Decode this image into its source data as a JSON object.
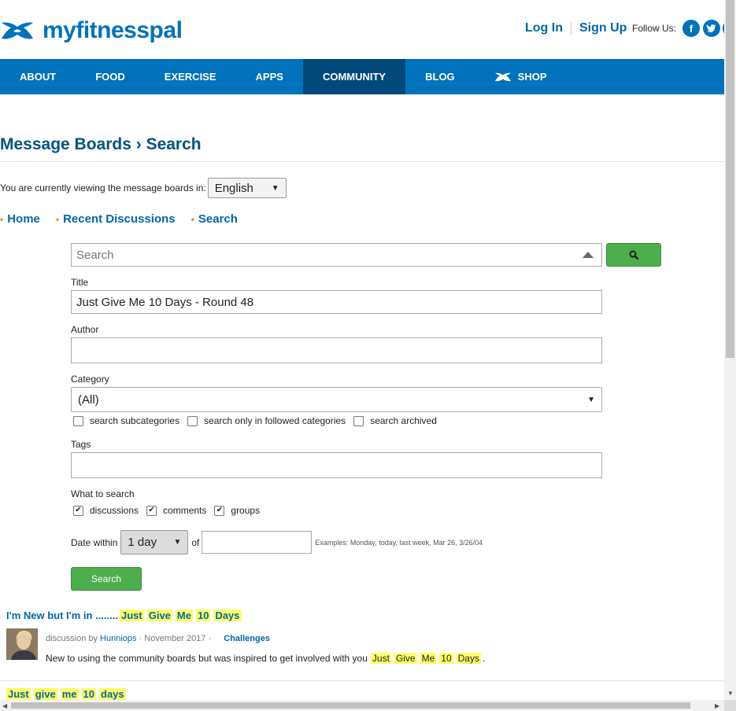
{
  "header": {
    "logo_text": "myfitnesspal",
    "login": "Log In",
    "signup": "Sign Up",
    "follow_us": "Follow Us:",
    "social": [
      "f",
      "t"
    ]
  },
  "nav": {
    "items": [
      "ABOUT",
      "FOOD",
      "EXERCISE",
      "APPS",
      "COMMUNITY",
      "BLOG",
      "SHOP"
    ],
    "active": "COMMUNITY"
  },
  "page": {
    "title": "Message Boards › Search",
    "locale_label": "You are currently viewing the message boards in:",
    "locale_value": "English",
    "crumbs": [
      "Home",
      "Recent Discussions",
      "Search"
    ]
  },
  "form": {
    "search_placeholder": "Search",
    "title_label": "Title",
    "title_value": "Just Give Me 10 Days - Round 48",
    "author_label": "Author",
    "author_value": "",
    "category_label": "Category",
    "category_value": "(All)",
    "category_options": [
      "search subcategories",
      "search only in followed categories",
      "search archived"
    ],
    "tags_label": "Tags",
    "tags_value": "",
    "what_label": "What to search",
    "what_options": [
      {
        "label": "discussions",
        "checked": true
      },
      {
        "label": "comments",
        "checked": true
      },
      {
        "label": "groups",
        "checked": true
      }
    ],
    "date_label": "Date within",
    "date_value": "1 day",
    "date_of": "of",
    "date_hint": "Examples: Monday, today, last week, Mar 26, 3/26/04",
    "search_button": "Search"
  },
  "results": [
    {
      "title_prefix": "I'm New but I'm in ........",
      "title_highlights": [
        "Just",
        "Give",
        "Me",
        "10",
        "Days"
      ],
      "type": "discussion by",
      "author": "Hunniops",
      "date": "· November 2017 ·",
      "category": "Challenges",
      "snippet_prefix": "New to using the community boards but was inspired to get involved with you",
      "snippet_highlights": [
        "Just",
        "Give",
        "Me",
        "10",
        "Days"
      ],
      "snippet_suffix": "."
    },
    {
      "title_prefix": "",
      "title_highlights": [
        "Just",
        "give",
        "me",
        "10",
        "days"
      ]
    }
  ],
  "colors": {
    "brand": "#0072bc",
    "nav_active": "#00497a",
    "title": "#00537f",
    "highlight": "#ffff66",
    "button": "#4cae4c"
  }
}
